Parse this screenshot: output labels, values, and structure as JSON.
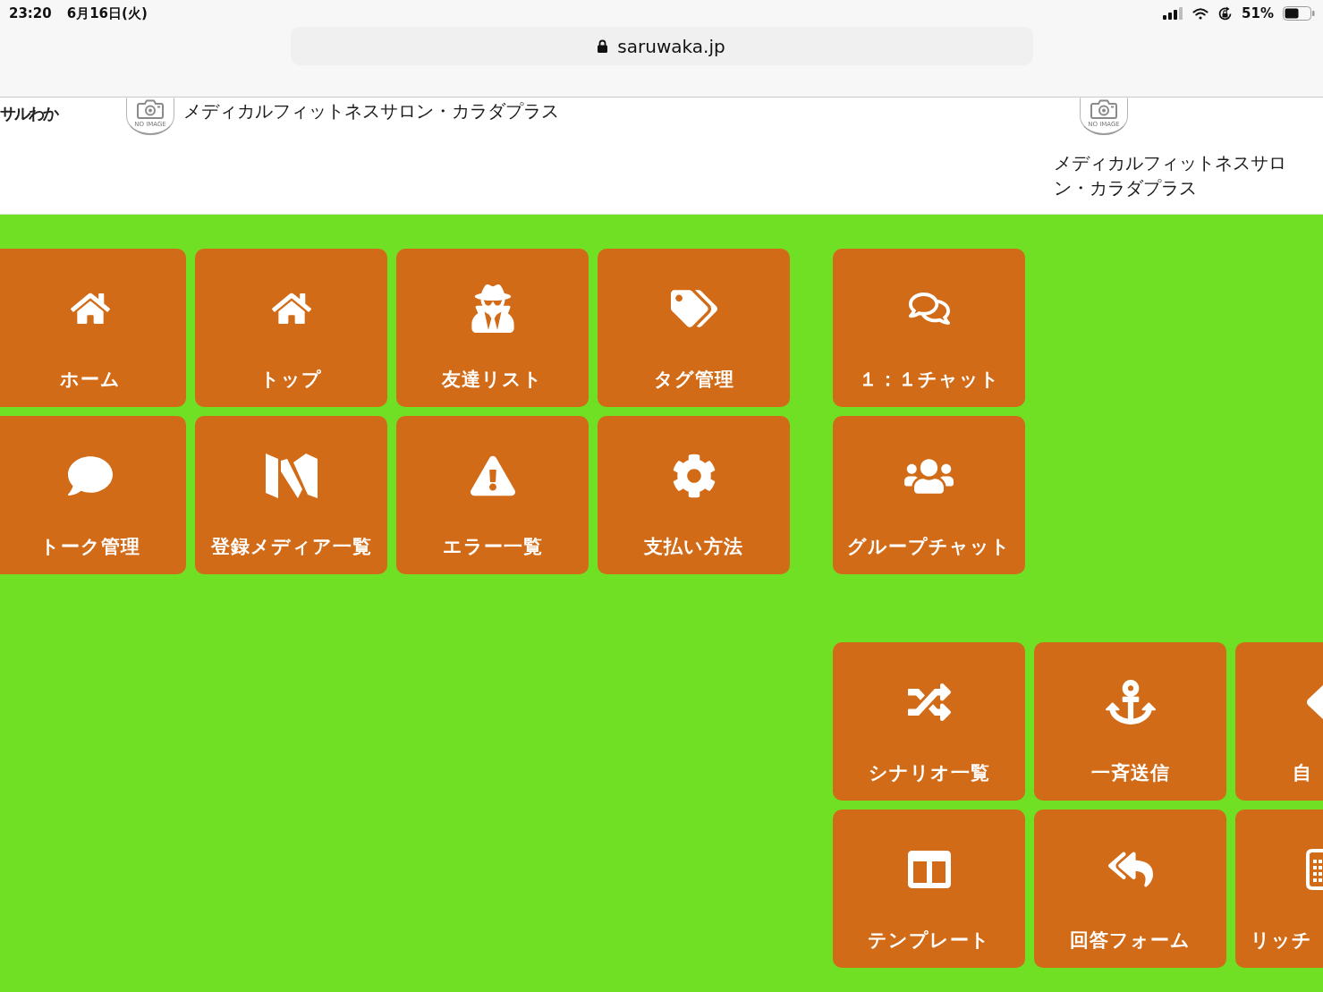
{
  "status_bar": {
    "time": "23:20",
    "date": "6月16日(火)",
    "battery_text": "51%"
  },
  "address_bar": {
    "url": "saruwaka.jp"
  },
  "header": {
    "logo": "サルわか",
    "shop": {
      "image_label": "NO IMAGE",
      "name": "メディカルフィットネスサロン・カラダプラス"
    },
    "shop_card": {
      "image_label": "NO IMAGE",
      "name": "メディカルフィットネスサロン・カラダプラス"
    }
  },
  "main_menu": {
    "rows": [
      [
        {
          "label": "ホーム",
          "kind": "home"
        },
        {
          "label": "トップ",
          "kind": "home"
        },
        {
          "label": "友達リスト",
          "kind": "agent"
        },
        {
          "label": "タグ管理",
          "kind": "tags"
        }
      ],
      [
        {
          "label": "トーク管理",
          "kind": "bubble"
        },
        {
          "label": "登録メディア一覧",
          "kind": "fold"
        },
        {
          "label": "エラー一覧",
          "kind": "warning"
        },
        {
          "label": "支払い方法",
          "kind": "gear"
        }
      ]
    ]
  },
  "chat_menu": {
    "tiles": [
      {
        "label": "１：１チャット",
        "kind": "dialog"
      },
      {
        "label": "グループチャット",
        "kind": "group"
      }
    ]
  },
  "message_menu": {
    "rows": [
      [
        {
          "label": "シナリオ一覧",
          "kind": "shuffle"
        },
        {
          "label": "一斉送信",
          "kind": "anchor"
        },
        {
          "label": "自",
          "kind": "point"
        }
      ],
      [
        {
          "label": "テンプレート",
          "kind": "columns"
        },
        {
          "label": "回答フォーム",
          "kind": "replyall"
        },
        {
          "label": "リッチ",
          "kind": "keypad"
        }
      ]
    ]
  }
}
